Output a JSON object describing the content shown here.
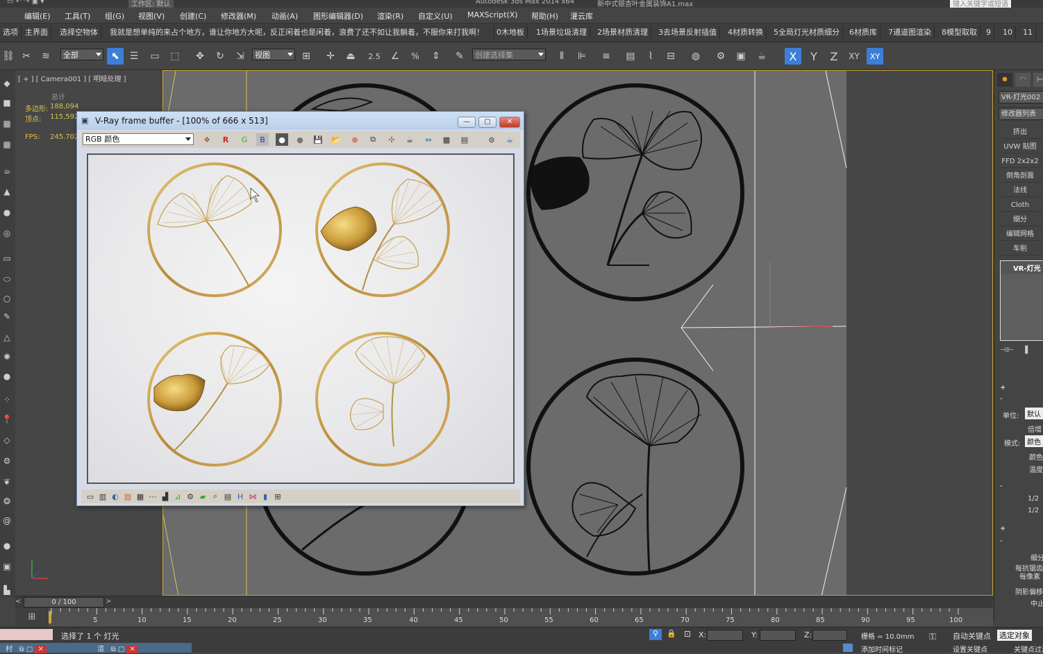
{
  "title_bar": {
    "workspace_label": "工作区: 默认",
    "app_title": "Autodesk 3ds Max  2014 x64",
    "file_title": "新中式银杏叶金属装饰A1.max",
    "search_placeholder": "键入关键字或短语"
  },
  "menu": [
    "编辑(E)",
    "工具(T)",
    "组(G)",
    "视图(V)",
    "创建(C)",
    "修改器(M)",
    "动画(A)",
    "图形编辑器(D)",
    "渲染(R)",
    "自定义(U)",
    "MAXScript(X)",
    "帮助(H)",
    "灌云库"
  ],
  "shortcut_bar": [
    "选项",
    "主界面",
    "选择空物体",
    "我就是想单纯的来占个地方，谁让你地方大呢，反正闲着也是闲着，浪费了还不如让我躺着，不服你来打我啊！",
    "0木地板",
    "1场景垃圾清理",
    "2场景材质清理",
    "3去场景反射插值",
    "4材质转换",
    "5全局灯光材质细分",
    "6材质库",
    "7通道图渲染",
    "8模型取取",
    "9",
    "10",
    "11"
  ],
  "main_toolbar": {
    "filter_select": "全部",
    "view_select": "视图",
    "snap_label": "2.5",
    "angle_label": "%",
    "selection_set_placeholder": "创建选择集",
    "axis_x": "X",
    "axis_y": "Y",
    "axis_z": "Z",
    "axis_xy": "XY",
    "axis_xy2": "XY"
  },
  "viewport": {
    "label": "[ + ] [ Camera001 ] [ 明暗处理 ]",
    "stats_total": "总计",
    "stats_polys_label": "多边形:",
    "stats_polys_value": "188,094",
    "stats_verts_label": "顶点:",
    "stats_verts_value": "115,592",
    "fps_label": "FPS:",
    "fps_value": "245.702"
  },
  "vfb": {
    "title": "V-Ray frame buffer - [100% of 666 x 513]",
    "channel_select": "RGB 颜色",
    "btn_r": "R",
    "btn_g": "G",
    "btn_b": "B"
  },
  "right_panel": {
    "object_name": "VR-灯光002",
    "modifier_list": "修改器列表",
    "modifiers": [
      "挤出",
      "UVW 贴图",
      "FFD 2x2x2",
      "倒角剖面",
      "法线",
      "Cloth",
      "细分",
      "编辑网格",
      "车削"
    ],
    "stack_item": "VR-灯光",
    "unit_label": "单位:",
    "unit_value": "默认",
    "multiplier_label": "倍增",
    "mode_label": "模式:",
    "mode_value": "颜色",
    "color_label": "颜色",
    "temp_label": "温度",
    "half1": "1/2",
    "half2": "1/2",
    "subdiv_label": "细分",
    "per_aa": "每抗锯齿",
    "per_view": "每像素",
    "shadow_bias": "阴影偏移",
    "cutoff": "中止"
  },
  "timeline": {
    "frame_counter": "0 / 100",
    "ticks": [
      "5",
      "10",
      "15",
      "20",
      "25",
      "30",
      "35",
      "40",
      "45",
      "50",
      "55",
      "60",
      "65",
      "70",
      "75",
      "80",
      "85",
      "90",
      "95",
      "100"
    ]
  },
  "status": {
    "selection_text": "选择了 1 个 灯光",
    "x_label": "X:",
    "y_label": "Y:",
    "z_label": "Z:",
    "grid_text": "栅格 = 10.0mm",
    "auto_key": "自动关键点",
    "selected_object": "选定对象",
    "set_key": "设置关键点",
    "key_filters": "关键点过滤器",
    "add_time_tag": "添加时间标记",
    "task_item": "渲"
  },
  "colors": {
    "accent_blue": "#3d7fd8",
    "viewport_border": "#c9a43a",
    "gold": "#c8a052"
  }
}
